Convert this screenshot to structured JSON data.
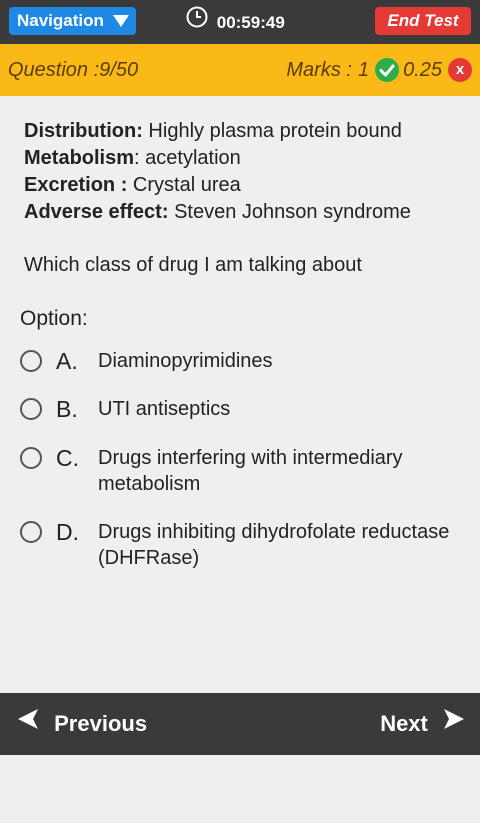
{
  "header": {
    "navigation_label": "Navigation",
    "timer": "00:59:49",
    "end_test_label": "End Test"
  },
  "status": {
    "question": "Question :9/50",
    "marks_label": "Marks :",
    "positive": "1",
    "negative": "0.25",
    "negative_icon_text": "x"
  },
  "question": {
    "lines": [
      {
        "key": "Distribution:",
        "value": " Highly plasma protein bound"
      },
      {
        "key": "Metabolism",
        "value": ": acetylation"
      },
      {
        "key": "Excretion :",
        "value": " Crystal urea"
      },
      {
        "key": "Adverse effect:",
        "value": " Steven Johnson syndrome"
      }
    ],
    "ask": "Which class of drug I am talking about"
  },
  "options_label": "Option:",
  "options": [
    {
      "letter": "A.",
      "text": "Diaminopyrimidines"
    },
    {
      "letter": "B.",
      "text": "UTI antiseptics"
    },
    {
      "letter": "C.",
      "text": "Drugs interfering with intermediary metabolism"
    },
    {
      "letter": "D.",
      "text": "Drugs inhibiting dihydrofolate reductase (DHFRase)"
    }
  ],
  "footer": {
    "previous_label": "Previous",
    "next_label": "Next"
  },
  "colors": {
    "topbar": "#3a3a3a",
    "accent_blue": "#1e88e5",
    "danger": "#e53935",
    "status_bar": "#fbb917",
    "ok_green": "#2eae4a"
  }
}
